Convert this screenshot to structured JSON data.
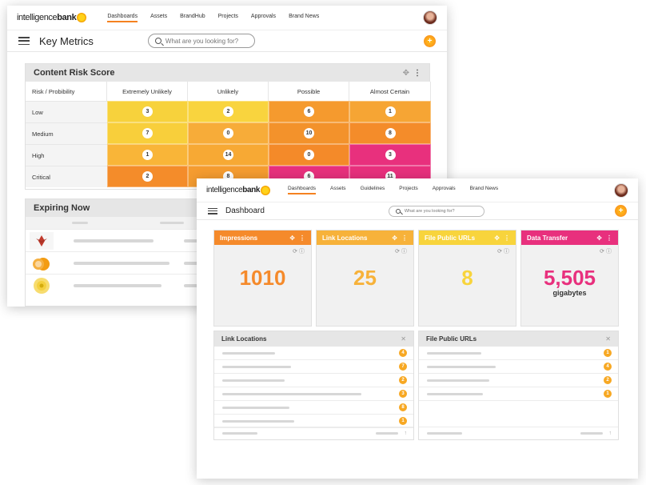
{
  "win1": {
    "logo_text_left": "intelligence",
    "logo_text_right": "bank",
    "nav": [
      "Dashboards",
      "Assets",
      "BrandHub",
      "Projects",
      "Approvals",
      "Brand News"
    ],
    "page_title": "Key Metrics",
    "search_placeholder": "What are you looking for?",
    "plus": "+",
    "risk": {
      "title": "Content Risk Score",
      "headers": [
        "Risk / Probibility",
        "Extremely Unlikely",
        "Unlikely",
        "Possible",
        "Almost Certain"
      ],
      "rows": [
        {
          "label": "Low",
          "values": [
            "3",
            "2",
            "6",
            "1"
          ]
        },
        {
          "label": "Medium",
          "values": [
            "7",
            "0",
            "10",
            "8"
          ]
        },
        {
          "label": "High",
          "values": [
            "1",
            "14",
            "0",
            "3"
          ]
        },
        {
          "label": "Critical",
          "values": [
            "2",
            "8",
            "6",
            "11"
          ]
        }
      ],
      "colors": [
        [
          "#f7d23c",
          "#f9d43e",
          "#f59a2e",
          "#f6a534"
        ],
        [
          "#f8cf3b",
          "#f7ac39",
          "#f3922b",
          "#f48c2a"
        ],
        [
          "#f9b538",
          "#f7a934",
          "#f48a29",
          "#e8307d"
        ],
        [
          "#f48c2a",
          "#f59c30",
          "#e8307d",
          "#e8307d"
        ]
      ]
    },
    "expiring": {
      "title": "Expiring Now",
      "thumbs": [
        "red-flower-icon",
        "orange-fruit-icon",
        "yellow-flower-icon"
      ]
    }
  },
  "win2": {
    "logo_text_left": "intelligence",
    "logo_text_right": "bank",
    "nav": [
      "Dashboards",
      "Assets",
      "Guidelines",
      "Projects",
      "Approvals",
      "Brand News"
    ],
    "page_title": "Dashboard",
    "search_placeholder": "What are you looking for?",
    "plus": "+",
    "kpis": [
      {
        "title": "Impressions",
        "value": "1010",
        "unit": "",
        "color": "#f58a2b"
      },
      {
        "title": "Link Locations",
        "value": "25",
        "unit": "",
        "color": "#f7b23a"
      },
      {
        "title": "File Public URLs",
        "value": "8",
        "unit": "",
        "color": "#f8d43c"
      },
      {
        "title": "Data Transfer",
        "value": "5,505",
        "unit": "gigabytes",
        "color": "#e8307d"
      }
    ],
    "lists": [
      {
        "title": "Link Locations",
        "badges": [
          "4",
          "7",
          "2",
          "3",
          "8",
          "1"
        ]
      },
      {
        "title": "File Public URLs",
        "badges": [
          "1",
          "4",
          "2",
          "1"
        ]
      }
    ]
  }
}
